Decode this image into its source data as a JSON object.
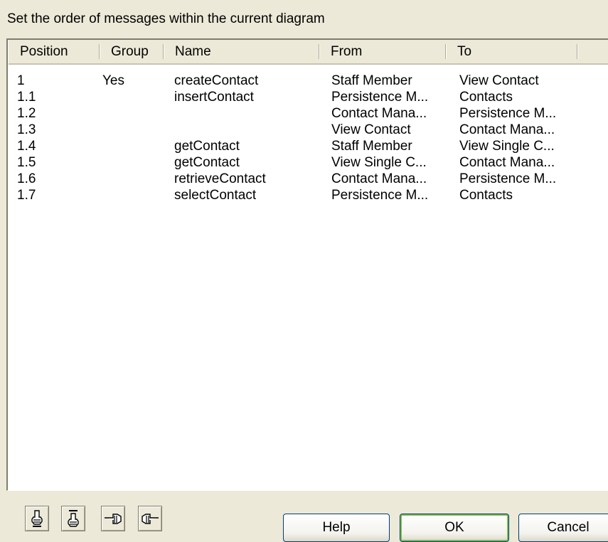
{
  "dialog": {
    "instruction": "Set the order of messages within the current diagram"
  },
  "table": {
    "columns": [
      "Position",
      "Group",
      "Name",
      "From",
      "To"
    ],
    "rows": [
      {
        "position": "1",
        "group": "Yes",
        "name": "createContact",
        "from": "Staff Member",
        "to": "View Contact"
      },
      {
        "position": "1.1",
        "group": "",
        "name": "insertContact",
        "from": "Persistence M...",
        "to": "Contacts"
      },
      {
        "position": "1.2",
        "group": "",
        "name": "",
        "from": "Contact Mana...",
        "to": "Persistence M..."
      },
      {
        "position": "1.3",
        "group": "",
        "name": "",
        "from": "View Contact",
        "to": "Contact Mana..."
      },
      {
        "position": "1.4",
        "group": "",
        "name": "getContact",
        "from": "Staff Member",
        "to": "View Single C..."
      },
      {
        "position": "1.5",
        "group": "",
        "name": "getContact",
        "from": "View Single C...",
        "to": "Contact Mana..."
      },
      {
        "position": "1.6",
        "group": "",
        "name": "retrieveContact",
        "from": "Contact Mana...",
        "to": "Persistence M..."
      },
      {
        "position": "1.7",
        "group": "",
        "name": "selectContact",
        "from": "Persistence M...",
        "to": "Contacts"
      }
    ]
  },
  "toolbar": {
    "icons": [
      "move-up-icon",
      "move-down-icon",
      "move-left-icon",
      "move-right-icon"
    ]
  },
  "buttons": {
    "help": "Help",
    "ok": "OK",
    "cancel": "Cancel"
  }
}
